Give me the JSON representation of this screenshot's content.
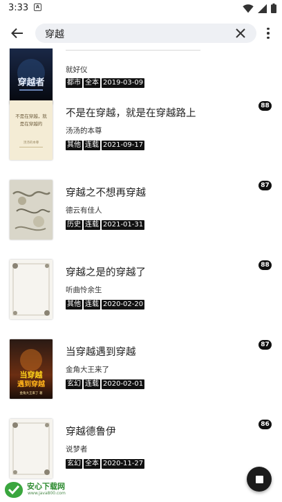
{
  "status_bar": {
    "time": "3:33",
    "notification_letter": "A"
  },
  "search": {
    "query": "穿越"
  },
  "books": [
    {
      "title": "",
      "author": "就好仪",
      "tags": [
        "都市",
        "全本",
        "2019-03-09"
      ],
      "score": ""
    },
    {
      "title": "不是在穿越，就是在穿越路上",
      "author": "汤汤的本尊",
      "tags": [
        "其他",
        "连载",
        "2021-09-17"
      ],
      "score": "88",
      "cover_text": [
        "不是在穿越，就",
        "是在穿越的",
        "汤汤的本尊"
      ]
    },
    {
      "title": "穿越之不想再穿越",
      "author": "德云有佳人",
      "tags": [
        "历史",
        "连载",
        "2021-01-31"
      ],
      "score": "87"
    },
    {
      "title": "穿越之是的穿越了",
      "author": "听曲怜余生",
      "tags": [
        "其他",
        "连载",
        "2020-02-20"
      ],
      "score": "88"
    },
    {
      "title": "当穿越遇到穿越",
      "author": "金角大王来了",
      "tags": [
        "玄幻",
        "连载",
        "2020-02-01"
      ],
      "score": "87",
      "cover_text": [
        "当穿越",
        "遇到穿越",
        "金角大王来了 著"
      ]
    },
    {
      "title": "穿越德鲁伊",
      "author": "说梦者",
      "tags": [
        "玄幻",
        "全本",
        "2020-11-27"
      ],
      "score": "86"
    }
  ],
  "first_cover_text": "穿越者",
  "watermark": {
    "name": "安心下载网",
    "url": "www.java800.com"
  }
}
